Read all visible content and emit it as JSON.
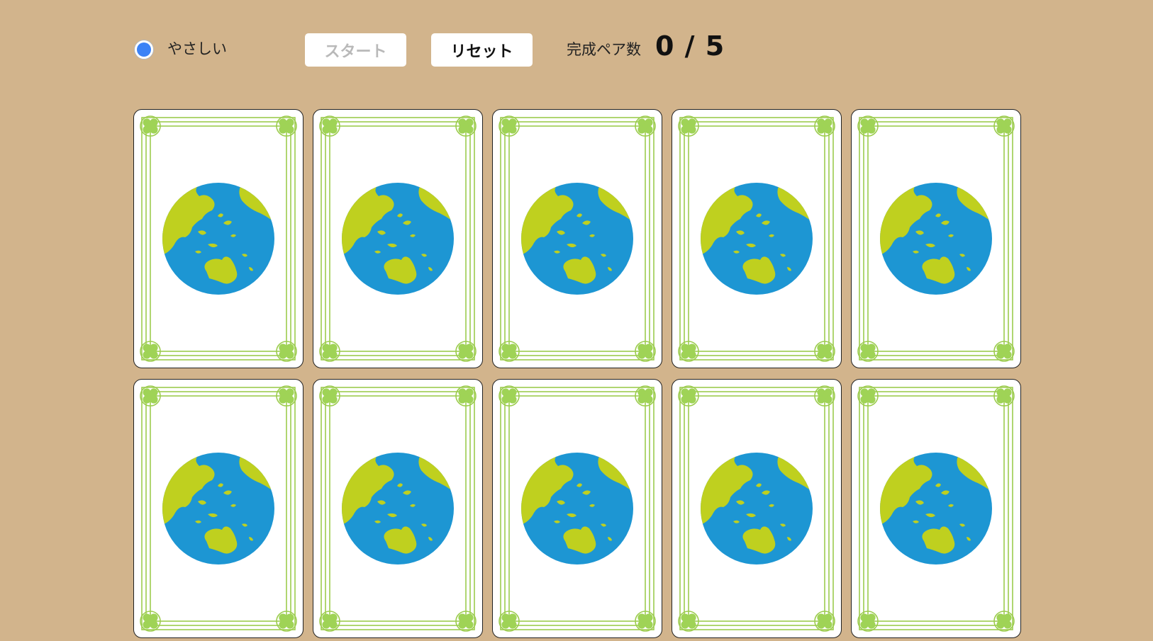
{
  "difficulty": {
    "label": "やさしい",
    "selected": true,
    "accent_color": "#3b82f6"
  },
  "buttons": {
    "start_label": "スタート",
    "start_enabled": false,
    "reset_label": "リセット"
  },
  "score": {
    "label": "完成ペア数",
    "completed": 0,
    "total": 5,
    "display": "0 / 5"
  },
  "board": {
    "background_color": "#d2b48c",
    "card_back_icon": "globe-icon",
    "card_corner_icon": "clover-icon",
    "cards": [
      {
        "row": 1,
        "col": 1,
        "face": "down"
      },
      {
        "row": 1,
        "col": 2,
        "face": "down"
      },
      {
        "row": 1,
        "col": 3,
        "face": "down"
      },
      {
        "row": 1,
        "col": 4,
        "face": "down"
      },
      {
        "row": 1,
        "col": 5,
        "face": "down"
      },
      {
        "row": 2,
        "col": 1,
        "face": "down"
      },
      {
        "row": 2,
        "col": 2,
        "face": "down"
      },
      {
        "row": 2,
        "col": 3,
        "face": "down"
      },
      {
        "row": 2,
        "col": 4,
        "face": "down"
      },
      {
        "row": 2,
        "col": 5,
        "face": "down"
      }
    ]
  },
  "colors": {
    "ocean": "#1d96d3",
    "land": "#bfd01f",
    "frame_green": "#9ccc4e",
    "clover": "#9fd356"
  }
}
